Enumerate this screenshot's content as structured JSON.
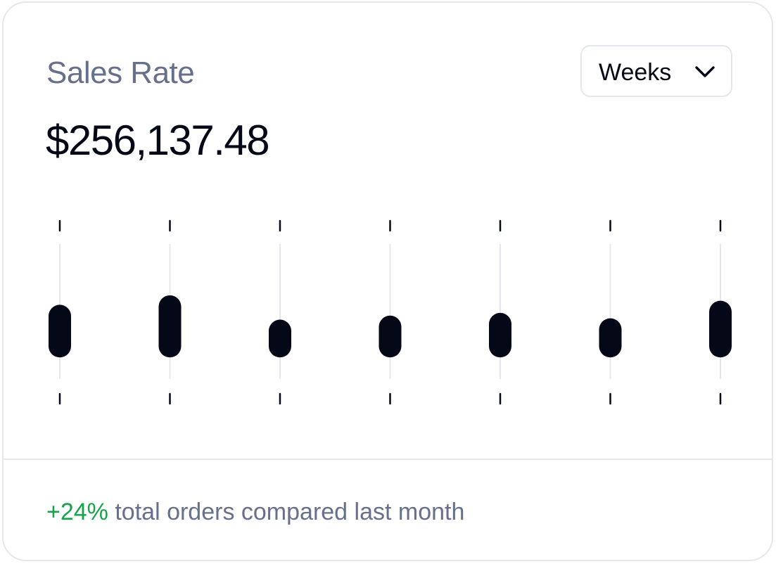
{
  "card": {
    "title": "Sales Rate",
    "amount": "$256,137.48",
    "period": {
      "selected": "Weeks",
      "icon": "chevron-down-icon"
    },
    "footer": {
      "change": "+24%",
      "text": "total orders compared last month"
    }
  },
  "colors": {
    "candle": "#050816",
    "wick_track": "#e4e8ee",
    "positive": "#16a34a",
    "muted_text": "#66708a"
  },
  "chart_data": {
    "type": "candlestick",
    "title": "",
    "xlabel": "",
    "ylabel": "",
    "axis_labels_visible": false,
    "ylim": [
      0,
      100
    ],
    "candles": [
      {
        "low": 0,
        "high": 100,
        "open": 16,
        "close": 55
      },
      {
        "low": 0,
        "high": 100,
        "open": 16,
        "close": 62
      },
      {
        "low": 0,
        "high": 100,
        "open": 16,
        "close": 44
      },
      {
        "low": 0,
        "high": 100,
        "open": 16,
        "close": 47
      },
      {
        "low": 0,
        "high": 100,
        "open": 16,
        "close": 49
      },
      {
        "low": 0,
        "high": 100,
        "open": 16,
        "close": 45
      },
      {
        "low": 0,
        "high": 100,
        "open": 16,
        "close": 58
      }
    ]
  }
}
